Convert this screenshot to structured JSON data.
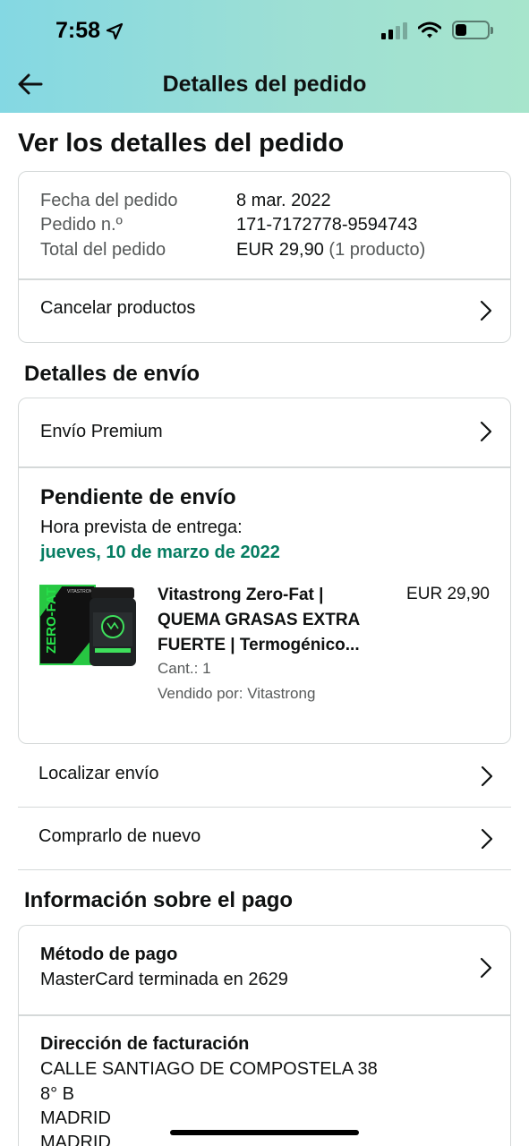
{
  "status_bar": {
    "time": "7:58",
    "icons": [
      "location-arrow-icon",
      "cellular-signal-icon",
      "wifi-icon",
      "battery-icon"
    ],
    "battery_level": 0.35
  },
  "nav": {
    "title": "Detalles del pedido",
    "back_icon": "back-arrow-icon"
  },
  "page_title": "Ver los detalles del pedido",
  "order_summary": {
    "date_label": "Fecha del pedido",
    "date_value": "8 mar. 2022",
    "number_label": "Pedido n.º",
    "number_value": "171-7172778-9594743",
    "total_label": "Total del pedido",
    "total_value": "EUR 29,90",
    "total_note": "(1 producto)",
    "cancel_label": "Cancelar productos"
  },
  "shipping": {
    "section_title": "Detalles de envío",
    "method_label": "Envío Premium",
    "status": "Pendiente de envío",
    "eta_label": "Hora prevista de entrega:",
    "eta_date": "jueves, 10 de marzo de 2022",
    "eta_color": "#067d62",
    "product": {
      "title_line1": "Vitastrong Zero-Fat |",
      "title_line2": "QUEMA GRASAS EXTRA",
      "title_line3": "FUERTE | Termogénico...",
      "price": "EUR 29,90",
      "quantity": "Cant.: 1",
      "seller": "Vendido por: Vitastrong",
      "image_text": "ZERO-FAT",
      "image_brand": "VITASTRONG"
    }
  },
  "actions": {
    "track_label": "Localizar envío",
    "buy_again_label": "Comprarlo de nuevo"
  },
  "payment": {
    "section_title": "Información sobre el pago",
    "method_title": "Método de pago",
    "method_value": "MasterCard terminada en 2629",
    "billing_title": "Dirección de facturación",
    "billing_line1": "CALLE SANTIAGO DE COMPOSTELA 38",
    "billing_line2": "8° B",
    "billing_line3": "MADRID",
    "billing_line4": "MADRID"
  }
}
